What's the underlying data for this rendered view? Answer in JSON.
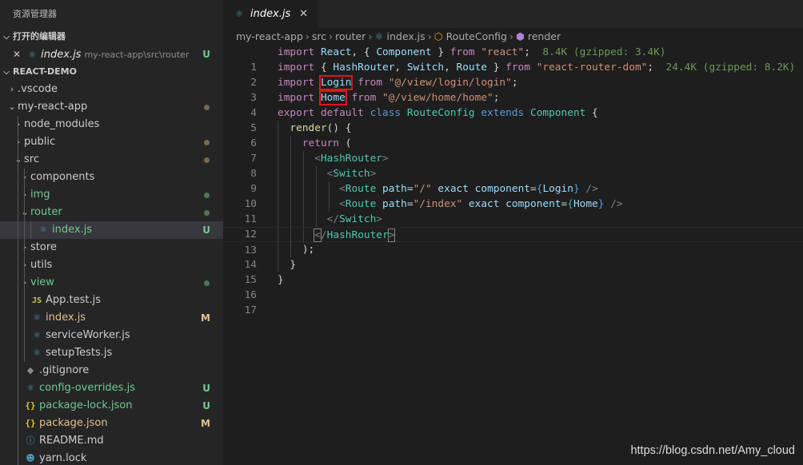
{
  "explorer": {
    "title": "资源管理器",
    "open_editors": {
      "header": "打开的编辑器",
      "items": [
        {
          "close": "✕",
          "name": "index.js",
          "path": "my-react-app\\src\\router",
          "status": "U"
        }
      ]
    },
    "project": {
      "header": "REACT-DEMO",
      "tree": [
        {
          "label": ".vscode",
          "type": "folder",
          "collapsed": true,
          "depth": 0
        },
        {
          "label": "my-react-app",
          "type": "folder",
          "collapsed": false,
          "depth": 0,
          "deco": "dot"
        },
        {
          "label": "node_modules",
          "type": "folder",
          "collapsed": true,
          "depth": 1
        },
        {
          "label": "public",
          "type": "folder",
          "collapsed": true,
          "depth": 1,
          "deco": "dot"
        },
        {
          "label": "src",
          "type": "folder",
          "collapsed": false,
          "depth": 1,
          "deco": "dot"
        },
        {
          "label": "components",
          "type": "folder",
          "collapsed": true,
          "depth": 2
        },
        {
          "label": "img",
          "type": "folder",
          "collapsed": true,
          "depth": 2,
          "deco": "green-dot"
        },
        {
          "label": "router",
          "type": "folder",
          "collapsed": false,
          "depth": 2,
          "deco": "green-dot"
        },
        {
          "label": "index.js",
          "type": "react",
          "depth": 3,
          "status": "U",
          "selected": true
        },
        {
          "label": "store",
          "type": "folder",
          "collapsed": true,
          "depth": 2
        },
        {
          "label": "utils",
          "type": "folder",
          "collapsed": true,
          "depth": 2
        },
        {
          "label": "view",
          "type": "folder",
          "collapsed": true,
          "depth": 2,
          "deco": "green-dot"
        },
        {
          "label": "App.test.js",
          "type": "js",
          "depth": 2
        },
        {
          "label": "index.js",
          "type": "react",
          "depth": 2,
          "status": "M"
        },
        {
          "label": "serviceWorker.js",
          "type": "react",
          "depth": 2
        },
        {
          "label": "setupTests.js",
          "type": "react",
          "depth": 2
        },
        {
          "label": ".gitignore",
          "type": "git",
          "depth": 1
        },
        {
          "label": "config-overrides.js",
          "type": "react",
          "depth": 1,
          "status": "U"
        },
        {
          "label": "package-lock.json",
          "type": "json",
          "depth": 1,
          "status": "U"
        },
        {
          "label": "package.json",
          "type": "json",
          "depth": 1,
          "status": "M"
        },
        {
          "label": "README.md",
          "type": "info",
          "depth": 1
        },
        {
          "label": "yarn.lock",
          "type": "yarn",
          "depth": 1
        }
      ]
    }
  },
  "tab": {
    "label": "index.js",
    "close": "✕"
  },
  "breadcrumb": [
    "my-react-app",
    "src",
    "router",
    "index.js",
    "RouteConfig",
    "render"
  ],
  "line_numbers": [
    "1",
    "2",
    "3",
    "4",
    "5",
    "6",
    "7",
    "8",
    "9",
    "10",
    "11",
    "12",
    "13",
    "14",
    "15",
    "16",
    "17"
  ],
  "code": {
    "import_hint_react": "8.4K (gzipped: 3.4K)",
    "import_hint_router": "24.4K (gzipped: 8.2K)"
  },
  "watermark": "https://blog.csdn.net/Amy_cloud",
  "colors": {
    "sidebar_bg": "#252526",
    "editor_bg": "#1e1e1e",
    "untracked": "#73c991",
    "modified": "#e2c08d",
    "highlight_box": "#e0141e"
  }
}
